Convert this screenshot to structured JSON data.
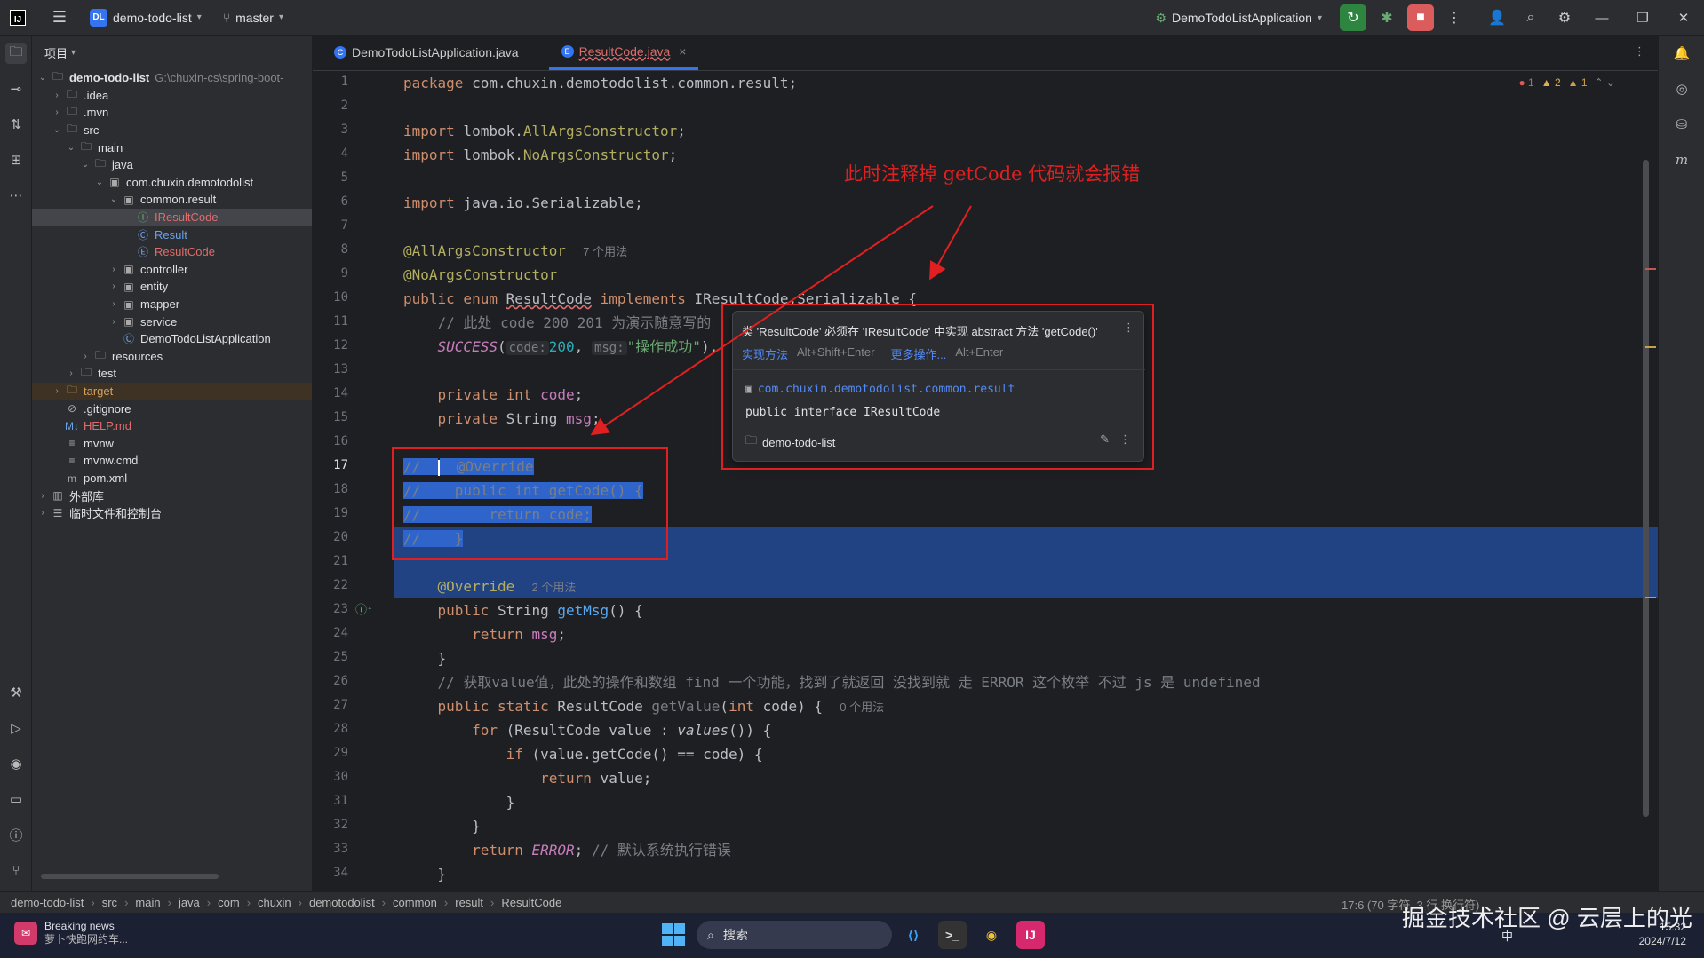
{
  "titlebar": {
    "logo": "IJ",
    "project_badge": "DL",
    "project_name": "demo-todo-list",
    "branch": "master",
    "run_config": "DemoTodoListApplication"
  },
  "project_panel": {
    "header": "项目",
    "tree": [
      {
        "label": "demo-todo-list",
        "extra": "G:\\chuxin-cs\\spring-boot-",
        "indent": 0,
        "arrow": "v",
        "icon": "folder-icon",
        "bold": true
      },
      {
        "label": ".idea",
        "indent": 1,
        "arrow": ">",
        "icon": "folder-icon"
      },
      {
        "label": ".mvn",
        "indent": 1,
        "arrow": ">",
        "icon": "folder-icon"
      },
      {
        "label": "src",
        "indent": 1,
        "arrow": "v",
        "icon": "folder-icon"
      },
      {
        "label": "main",
        "indent": 2,
        "arrow": "v",
        "icon": "folder-icon"
      },
      {
        "label": "java",
        "indent": 3,
        "arrow": "v",
        "icon": "folder-icon"
      },
      {
        "label": "com.chuxin.demotodolist",
        "indent": 4,
        "arrow": "v",
        "icon": "package-icon"
      },
      {
        "label": "common.result",
        "indent": 5,
        "arrow": "v",
        "icon": "package-icon"
      },
      {
        "label": "IResultCode",
        "indent": 6,
        "arrow": "",
        "icon": "interface-icon",
        "style": "red",
        "selected": true
      },
      {
        "label": "Result",
        "indent": 6,
        "arrow": "",
        "icon": "class-icon",
        "style": "blue"
      },
      {
        "label": "ResultCode",
        "indent": 6,
        "arrow": "",
        "icon": "enum-icon",
        "style": "red"
      },
      {
        "label": "controller",
        "indent": 5,
        "arrow": ">",
        "icon": "package-icon"
      },
      {
        "label": "entity",
        "indent": 5,
        "arrow": ">",
        "icon": "package-icon"
      },
      {
        "label": "mapper",
        "indent": 5,
        "arrow": ">",
        "icon": "package-icon"
      },
      {
        "label": "service",
        "indent": 5,
        "arrow": ">",
        "icon": "package-icon"
      },
      {
        "label": "DemoTodoListApplication",
        "indent": 5,
        "arrow": "",
        "icon": "spring-class-icon"
      },
      {
        "label": "resources",
        "indent": 3,
        "arrow": ">",
        "icon": "folder-icon"
      },
      {
        "label": "test",
        "indent": 2,
        "arrow": ">",
        "icon": "folder-icon"
      },
      {
        "label": "target",
        "indent": 1,
        "arrow": ">",
        "icon": "folder-icon",
        "style": "orange",
        "highlight": true
      },
      {
        "label": ".gitignore",
        "indent": 1,
        "arrow": "",
        "icon": "gitignore-icon"
      },
      {
        "label": "HELP.md",
        "indent": 1,
        "arrow": "",
        "icon": "markdown-icon",
        "style": "red"
      },
      {
        "label": "mvnw",
        "indent": 1,
        "arrow": "",
        "icon": "file-icon"
      },
      {
        "label": "mvnw.cmd",
        "indent": 1,
        "arrow": "",
        "icon": "file-icon"
      },
      {
        "label": "pom.xml",
        "indent": 1,
        "arrow": "",
        "icon": "maven-icon"
      },
      {
        "label": "外部库",
        "indent": 0,
        "arrow": ">",
        "icon": "library-icon"
      },
      {
        "label": "临时文件和控制台",
        "indent": 0,
        "arrow": ">",
        "icon": "scratch-icon"
      }
    ]
  },
  "tabs": [
    {
      "label": "DemoTodoListApplication.java",
      "active": false
    },
    {
      "label": "ResultCode.java",
      "active": true,
      "close": "×"
    }
  ],
  "editor": {
    "inspection": {
      "errors": "1",
      "warnings": "2",
      "weak": "1"
    },
    "line_numbers": [
      "1",
      "2",
      "3",
      "4",
      "5",
      "6",
      "7",
      "8",
      "9",
      "10",
      "11",
      "12",
      "13",
      "14",
      "15",
      "16",
      "17",
      "18",
      "19",
      "20",
      "21",
      "22",
      "23",
      "24",
      "25",
      "26",
      "27",
      "28",
      "29",
      "30",
      "31",
      "32",
      "33",
      "34"
    ],
    "hints": {
      "usages7": "7 个用法",
      "usages2": "2 个用法",
      "usages0": "0 个用法",
      "code_param": "code:",
      "msg_param": "msg:"
    }
  },
  "popup": {
    "message": "类 'ResultCode' 必须在 'IResultCode' 中实现 abstract 方法 'getCode()'",
    "action1": "实现方法",
    "action1_key": "Alt+Shift+Enter",
    "action2": "更多操作...",
    "action2_key": "Alt+Enter",
    "package": "com.chuxin.demotodolist.common.result",
    "declaration": "public interface IResultCode",
    "module": "demo-todo-list"
  },
  "annotation_note": "此时注释掉 getCode 代码就会报错",
  "statusbar": {
    "breadcrumbs": [
      "demo-todo-list",
      "src",
      "main",
      "java",
      "com",
      "chuxin",
      "demotodolist",
      "common",
      "result",
      "ResultCode"
    ],
    "position": "17:6 (70 字符, 3 行 换行符)"
  },
  "taskbar": {
    "news_title": "Breaking news",
    "news_sub": "萝卜快跑网约车...",
    "search_placeholder": "搜索",
    "time": "15:32",
    "date": "2024/7/12",
    "ime": "中",
    "watermark": "掘金技术社区 @ 云层上的光"
  },
  "colors": {
    "accent": "#3574f0",
    "error_red": "#e02020",
    "selection": "#214283"
  }
}
